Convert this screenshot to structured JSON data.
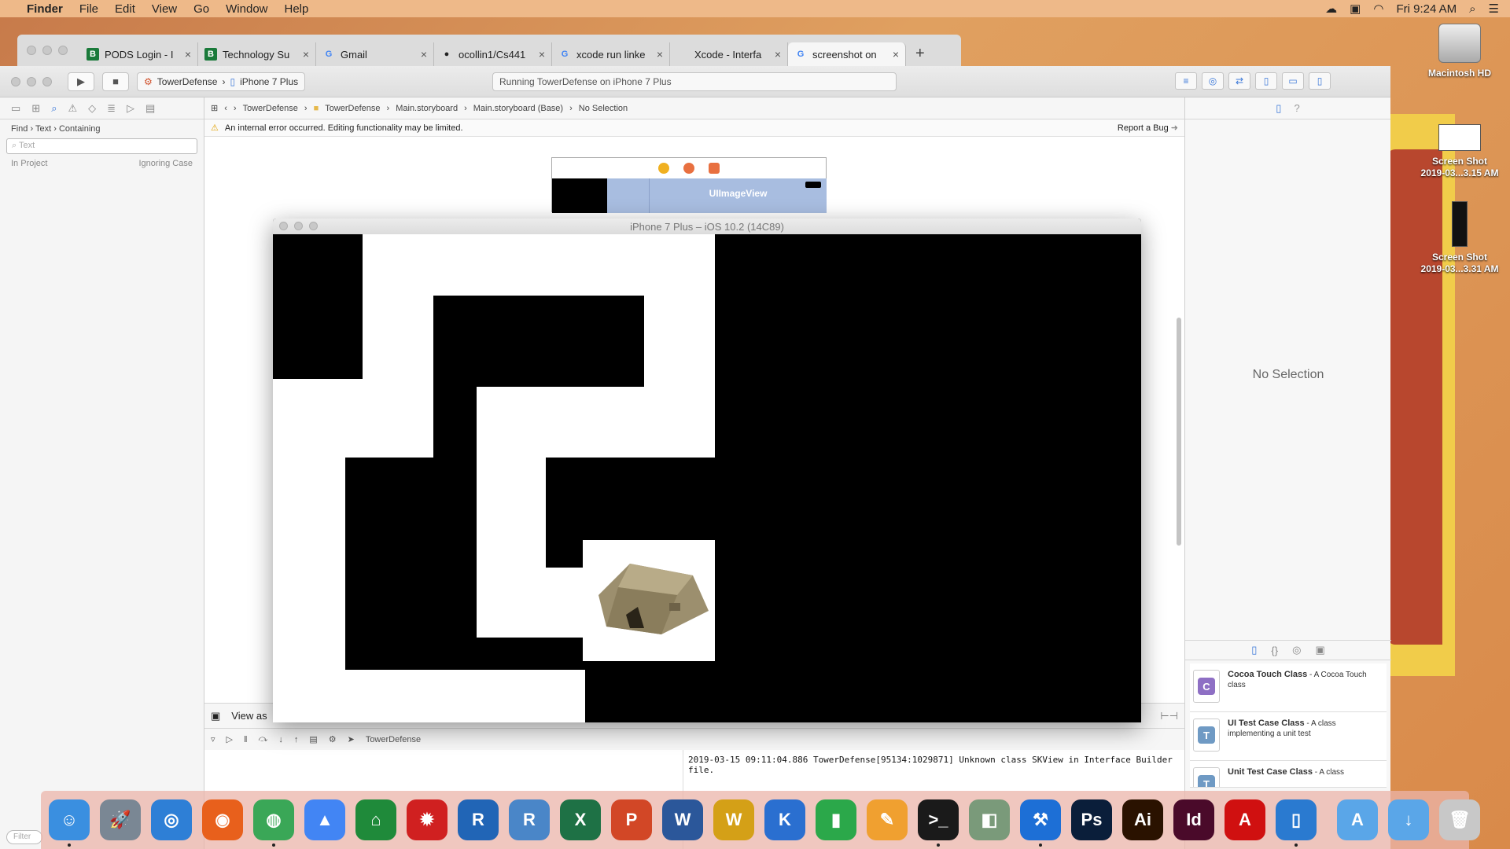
{
  "menubar": {
    "app": "Finder",
    "items": [
      "File",
      "Edit",
      "View",
      "Go",
      "Window",
      "Help"
    ],
    "clock": "Fri 9:24 AM"
  },
  "desktop": {
    "hd_label": "Macintosh HD",
    "shot1": {
      "line1": "Screen Shot",
      "line2": "2019-03...3.15 AM"
    },
    "shot2": {
      "line1": "Screen Shot",
      "line2": "2019-03...3.31 AM"
    }
  },
  "chrome": {
    "tabs": [
      {
        "label": "PODS Login - I",
        "icon": "B",
        "color": "#1a7a3a"
      },
      {
        "label": "Technology Su",
        "icon": "B",
        "color": "#1a7a3a"
      },
      {
        "label": "Gmail",
        "icon": "G",
        "color": "#4285f4"
      },
      {
        "label": "ocollin1/Cs441",
        "icon": "●",
        "color": "#222"
      },
      {
        "label": "xcode run linke",
        "icon": "G",
        "color": "#4285f4"
      },
      {
        "label": "Xcode - Interfa",
        "icon": "",
        "color": "#222"
      },
      {
        "label": "screenshot on",
        "icon": "G",
        "color": "#4285f4"
      }
    ],
    "new_tab": "+"
  },
  "xcode": {
    "scheme": "TowerDefense",
    "device": "iPhone 7 Plus",
    "activity": "Running TowerDefense on iPhone 7 Plus",
    "find": {
      "path": [
        "Find",
        "Text",
        "Containing"
      ],
      "placeholder": "Text",
      "scope": "In Project",
      "case": "Ignoring Case",
      "filter_placeholder": "Filter"
    },
    "jumpbar": [
      "TowerDefense",
      "TowerDefense",
      "Main.storyboard",
      "Main.storyboard (Base)",
      "No Selection"
    ],
    "warning": "An internal error occurred. Editing functionality may be limited.",
    "report_bug": "Report a Bug",
    "imageview_label": "UIImageView",
    "view_as": "View as",
    "debug_target": "TowerDefense",
    "console_line": "2019-03-15 09:11:04.886 TowerDefense[95134:1029871] Unknown class SKView in Interface Builder file."
  },
  "inspector": {
    "no_selection": "No Selection",
    "library": [
      {
        "title": "Cocoa Touch Class",
        "desc": "A Cocoa Touch class",
        "letter": "C",
        "color": "#8e6fc4"
      },
      {
        "title": "UI Test Case Class",
        "desc": "A class implementing a unit test",
        "letter": "T",
        "color": "#6f9ac4"
      },
      {
        "title": "Unit Test Case Class",
        "desc": "A class",
        "letter": "T",
        "color": "#6f9ac4"
      }
    ]
  },
  "simulator": {
    "title": "iPhone 7 Plus – iOS 10.2 (14C89)"
  },
  "dock": [
    {
      "name": "finder-icon",
      "label": "☺",
      "color": "#3a8fe0"
    },
    {
      "name": "launchpad-icon",
      "label": "🚀",
      "color": "#7a8794"
    },
    {
      "name": "safari-icon",
      "label": "◎",
      "color": "#2e7fd6"
    },
    {
      "name": "firefox-icon",
      "label": "◉",
      "color": "#e8601c"
    },
    {
      "name": "chrome-icon",
      "label": "◍",
      "color": "#3aa757"
    },
    {
      "name": "google-drive-icon",
      "label": "▲",
      "color": "#4285f4"
    },
    {
      "name": "remote-desktop-icon",
      "label": "⌂",
      "color": "#1f8a3a"
    },
    {
      "name": "mathematica-icon",
      "label": "✹",
      "color": "#d02020"
    },
    {
      "name": "r-icon",
      "label": "R",
      "color": "#2165b6"
    },
    {
      "name": "rstudio-icon",
      "label": "R",
      "color": "#4a86c8"
    },
    {
      "name": "excel-icon",
      "label": "X",
      "color": "#1e7145"
    },
    {
      "name": "powerpoint-icon",
      "label": "P",
      "color": "#d24726"
    },
    {
      "name": "word-icon",
      "label": "W",
      "color": "#2b579a"
    },
    {
      "name": "wireshark-icon",
      "label": "W",
      "color": "#d4a017"
    },
    {
      "name": "keynote-icon",
      "label": "K",
      "color": "#2a6fd0"
    },
    {
      "name": "numbers-icon",
      "label": "▮",
      "color": "#2ba84a"
    },
    {
      "name": "pages-icon",
      "label": "✎",
      "color": "#f0a030"
    },
    {
      "name": "terminal-icon",
      "label": ">_",
      "color": "#1a1a1a"
    },
    {
      "name": "preview-icon",
      "label": "◧",
      "color": "#7a9a7a"
    },
    {
      "name": "xcode-icon",
      "label": "⚒",
      "color": "#1d6fd6"
    },
    {
      "name": "photoshop-icon",
      "label": "Ps",
      "color": "#0a1e3a"
    },
    {
      "name": "illustrator-icon",
      "label": "Ai",
      "color": "#2a1200"
    },
    {
      "name": "indesign-icon",
      "label": "Id",
      "color": "#4a0a2a"
    },
    {
      "name": "acrobat-icon",
      "label": "A",
      "color": "#d01010"
    },
    {
      "name": "simulator-icon",
      "label": "▯",
      "color": "#2a7ad0"
    },
    {
      "name": "applications-folder-icon",
      "label": "A",
      "color": "#5aa6e8"
    },
    {
      "name": "downloads-folder-icon",
      "label": "↓",
      "color": "#5aa6e8"
    },
    {
      "name": "trash-icon",
      "label": "🗑",
      "color": "#c8c8c8"
    }
  ]
}
